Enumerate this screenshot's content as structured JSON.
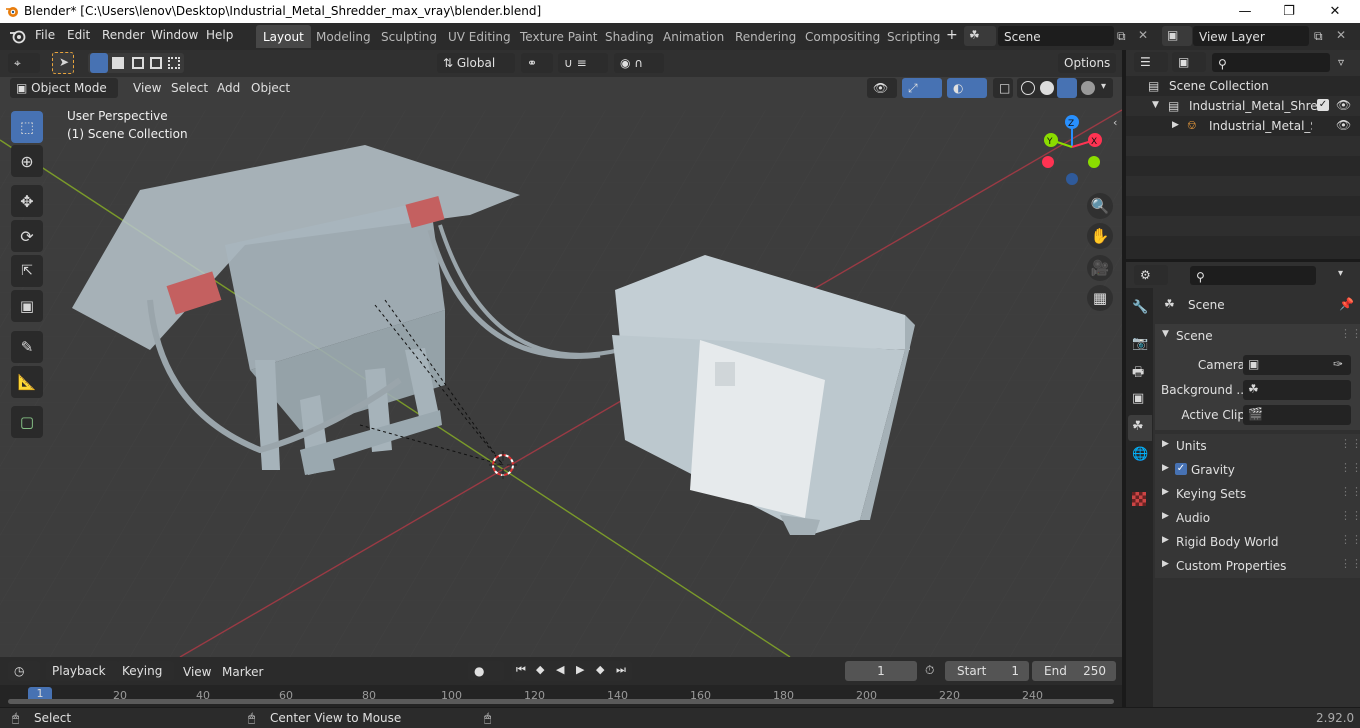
{
  "title_bar": {
    "title": "Blender* [C:\\Users\\lenov\\Desktop\\Industrial_Metal_Shredder_max_vray\\blender.blend]",
    "minimize": "—",
    "maximize": "❐",
    "close": "✕"
  },
  "menu": {
    "file": "File",
    "edit": "Edit",
    "render": "Render",
    "window": "Window",
    "help": "Help"
  },
  "workspaces": [
    "Layout",
    "Modeling",
    "Sculpting",
    "UV Editing",
    "Texture Paint",
    "Shading",
    "Animation",
    "Rendering",
    "Compositing",
    "Scripting"
  ],
  "workspace_add": "+",
  "scene_selector": {
    "value": "Scene"
  },
  "view_layer_selector": {
    "value": "View Layer"
  },
  "viewport_header": {
    "transform_orientation": "Global",
    "options": "Options",
    "mode": "Object Mode",
    "view": "View",
    "select": "Select",
    "add": "Add",
    "object": "Object"
  },
  "viewport_overlay": {
    "perspective": "User Perspective",
    "collection": "(1) Scene Collection"
  },
  "gizmo": {
    "x": "X",
    "y": "Y",
    "z": "Z"
  },
  "outliner": {
    "root": "Scene Collection",
    "collection": "Industrial_Metal_Shredde",
    "object": "Industrial_Metal_Shre"
  },
  "properties": {
    "header": "Scene",
    "section": "Scene",
    "fields": [
      {
        "label": "Camera"
      },
      {
        "label": "Background ..."
      },
      {
        "label": "Active Clip"
      }
    ],
    "panels": [
      "Units",
      "Gravity",
      "Keying Sets",
      "Audio",
      "Rigid Body World",
      "Custom Properties"
    ]
  },
  "timeline": {
    "playback": "Playback",
    "keying": "Keying",
    "view": "View",
    "marker": "Marker",
    "current_frame": "1",
    "start_label": "Start",
    "start_value": "1",
    "end_label": "End",
    "end_value": "250",
    "ticks": [
      "1",
      "20",
      "40",
      "60",
      "80",
      "100",
      "120",
      "140",
      "160",
      "180",
      "200",
      "220",
      "240"
    ]
  },
  "status_bar": {
    "select": "Select",
    "center_view": "Center View to Mouse",
    "version": "2.92.0"
  },
  "colors": {
    "accent": "#4772b3",
    "x_axis": "#ff3352",
    "y_axis": "#8bdc00",
    "z_axis": "#2890ff"
  }
}
